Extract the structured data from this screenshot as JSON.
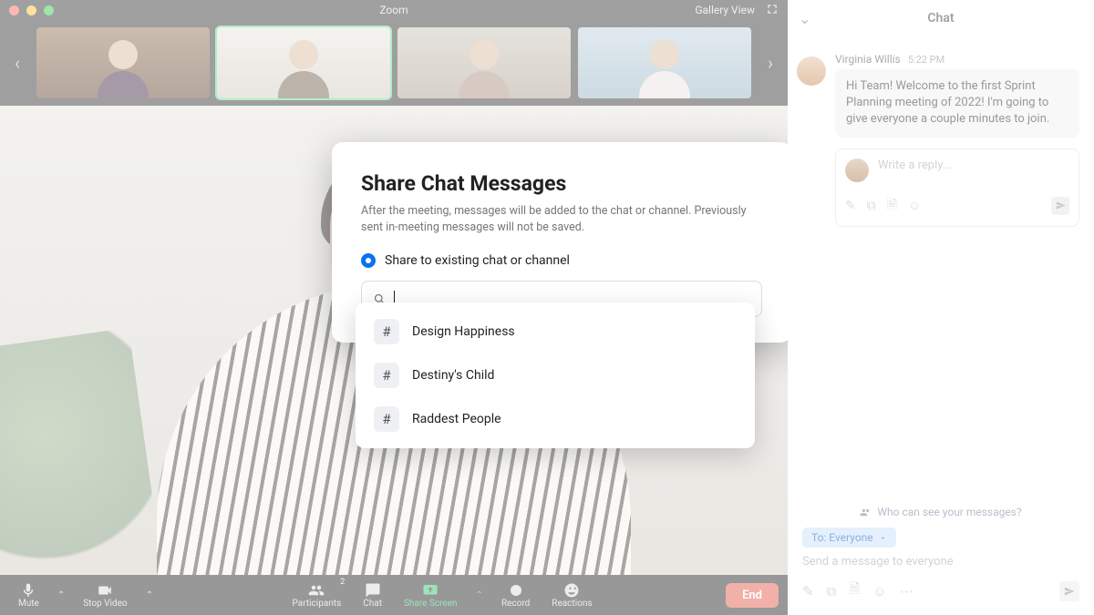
{
  "window": {
    "title": "Zoom",
    "view_mode": "Gallery View"
  },
  "toolbar": {
    "mute": "Mute",
    "stop_video": "Stop Video",
    "participants": "Participants",
    "participants_count": "2",
    "chat": "Chat",
    "share_screen": "Share Screen",
    "record": "Record",
    "reactions": "Reactions",
    "end": "End"
  },
  "modal": {
    "title": "Share Chat Messages",
    "subtitle": "After the meeting, messages will be added to the chat or channel. Previously sent in-meeting messages will not be saved.",
    "radio_label": "Share to existing chat or channel",
    "options": [
      "Design Happiness",
      "Destiny's Child",
      "Raddest People"
    ]
  },
  "chat": {
    "title": "Chat",
    "sender": "Virginia Willis",
    "time": "5:22 PM",
    "message": "Hi Team! Welcome to the first Sprint Planning meeting of 2022! I'm going to give everyone a couple minutes to join.",
    "reply_placeholder": "Write a reply...",
    "who_can_see": "Who can see your messages?",
    "to_label": "To: Everyone",
    "compose_placeholder": "Send a message to everyone"
  }
}
